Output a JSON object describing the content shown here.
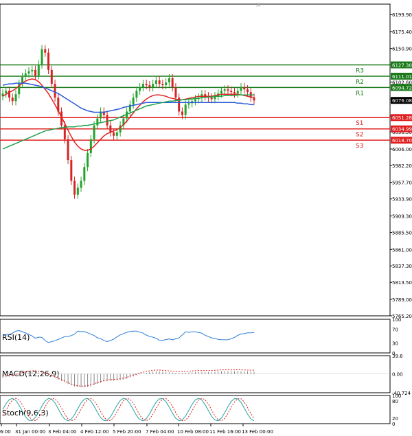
{
  "chart_data": {
    "type": "candlestick",
    "y_axis": {
      "ticks": [
        "6199.90",
        "6175.40",
        "6150.90",
        "6127.30",
        "6102.60",
        "6078.10",
        "6053.60",
        "6030.50",
        "6006.00",
        "5982.20",
        "5957.70",
        "5933.90",
        "5909.30",
        "5885.50",
        "5861.00",
        "5837.30",
        "5813.50",
        "5789.00",
        "5765.20"
      ],
      "range": [
        5765.2,
        6215.0
      ]
    },
    "x_axis": {
      "tick_labels": [
        "6:00",
        "31 Jan 00:00",
        "3 Feb 04:00",
        "4 Feb 12:00",
        "5 Feb 20:00",
        "7 Feb 04:00",
        "10 Feb 08:00",
        "11 Feb 16:00",
        "13 Feb 00:00"
      ]
    },
    "current_price": "6076.08",
    "levels": [
      {
        "name": "R3",
        "value": "6127.30",
        "color": "#1a7a1a"
      },
      {
        "name": "R2",
        "value": "6111.01",
        "color": "#1a7a1a"
      },
      {
        "name": "R1",
        "value": "6094.72",
        "color": "#1a7a1a"
      },
      {
        "name": "S1",
        "value": "6051.28",
        "color": "#e02020"
      },
      {
        "name": "S2",
        "value": "6034.99",
        "color": "#e02020"
      },
      {
        "name": "S3",
        "value": "6018.70",
        "color": "#e02020"
      }
    ],
    "series": [
      {
        "name": "price",
        "values": [
          6086,
          6090,
          6080,
          6075,
          6085,
          6100,
          6110,
          6115,
          6118,
          6120,
          6112,
          6128,
          6150,
          6145,
          6120,
          6100,
          6080,
          6060,
          6040,
          6020,
          5990,
          5960,
          5940,
          5950,
          5960,
          5980,
          6000,
          6020,
          6040,
          6050,
          6060,
          6055,
          6040,
          6030,
          6025,
          6030,
          6040,
          6050,
          6060,
          6070,
          6080,
          6090,
          6095,
          6100,
          6098,
          6095,
          6100,
          6105,
          6100,
          6098,
          6102,
          6108,
          6095,
          6080,
          6060,
          6055,
          6070,
          6072,
          6075,
          6078,
          6080,
          6085,
          6082,
          6080,
          6078,
          6082,
          6086,
          6090,
          6092,
          6090,
          6088,
          6086,
          6090,
          6095,
          6092,
          6088,
          6080,
          6076
        ]
      },
      {
        "name": "ma_red",
        "values": [
          6082,
          6085,
          6088,
          6090,
          6093,
          6097,
          6101,
          6104,
          6106,
          6107,
          6106,
          6103,
          6098,
          6092,
          6086,
          6078,
          6070,
          6061,
          6052,
          6043,
          6033,
          6024,
          6016,
          6010,
          6006,
          6004,
          6004,
          6006,
          6010,
          6015,
          6020,
          6025,
          6028,
          6030,
          6032,
          6034,
          6037,
          6041,
          6046,
          6052,
          6058,
          6064,
          6069,
          6074,
          6078,
          6081,
          6083,
          6084,
          6084,
          6083,
          6082,
          6080,
          6079,
          6078,
          6077,
          6077,
          6078,
          6079,
          6080,
          6081,
          6082,
          6082,
          6082,
          6082,
          6082,
          6083,
          6084,
          6085,
          6085,
          6085,
          6085,
          6085,
          6085,
          6084,
          6083,
          6082,
          6081,
          6080
        ]
      },
      {
        "name": "ma_blue",
        "values": [
          6098,
          6099,
          6100,
          6100,
          6101,
          6101,
          6101,
          6101,
          6100,
          6099,
          6098,
          6097,
          6096,
          6094,
          6092,
          6090,
          6088,
          6086,
          6083,
          6080,
          6077,
          6074,
          6071,
          6068,
          6065,
          6063,
          6061,
          6060,
          6059,
          6059,
          6059,
          6059,
          6060,
          6061,
          6062,
          6063,
          6064,
          6066,
          6067,
          6068,
          6069,
          6070,
          6071,
          6072,
          6073,
          6073,
          6073,
          6073,
          6073,
          6073,
          6073,
          6073,
          6073,
          6073,
          6073,
          6073,
          6073,
          6073,
          6073,
          6073,
          6073,
          6073,
          6073,
          6073,
          6073,
          6073,
          6073,
          6073,
          6073,
          6073,
          6073,
          6073,
          6072,
          6072,
          6071,
          6071,
          6070,
          6070
        ]
      },
      {
        "name": "ma_green",
        "values": [
          6006,
          6008,
          6010,
          6012,
          6014,
          6016,
          6018,
          6020,
          6022,
          6024,
          6026,
          6028,
          6030,
          6032,
          6033,
          6034,
          6035,
          6036,
          6037,
          6037,
          6038,
          6038,
          6038,
          6039,
          6039,
          6040,
          6040,
          6041,
          6042,
          6043,
          6044,
          6045,
          6046,
          6047,
          6048,
          6050,
          6052,
          6054,
          6056,
          6058,
          6060,
          6062,
          6064,
          6066,
          6068,
          6069,
          6070,
          6071,
          6072,
          6073,
          6074,
          6075,
          6075,
          6076,
          6076,
          6077,
          6077,
          6078,
          6078,
          6079,
          6079,
          6080,
          6080,
          6081,
          6081,
          6082,
          6082,
          6082,
          6083,
          6083,
          6083,
          6083,
          6084,
          6084,
          6084,
          6084,
          6084,
          6084
        ]
      }
    ],
    "indicators": [
      {
        "name": "RSI(14)",
        "ticks": [
          "100",
          "70",
          "30",
          "0"
        ]
      },
      {
        "name": "MACD(12,26,9)",
        "ticks": [
          "39.6",
          "0.00",
          "-40.724"
        ]
      },
      {
        "name": "Stoch(9,6,3)",
        "ticks": [
          "100",
          "80",
          "20",
          "0"
        ]
      }
    ]
  }
}
